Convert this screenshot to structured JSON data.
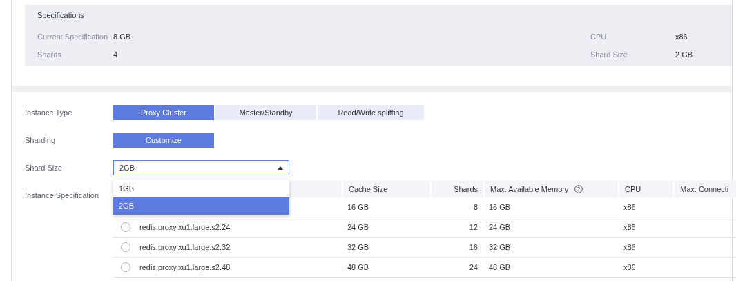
{
  "specifications": {
    "title": "Specifications",
    "items": [
      {
        "label": "Current Specification",
        "value": "8 GB"
      },
      {
        "label": "CPU",
        "value": "x86"
      },
      {
        "label": "Shards",
        "value": "4"
      },
      {
        "label": "Shard Size",
        "value": "2 GB"
      }
    ]
  },
  "instance_type": {
    "label": "Instance Type",
    "options": [
      {
        "label": "Proxy Cluster",
        "selected": true
      },
      {
        "label": "Master/Standby",
        "selected": false
      },
      {
        "label": "Read/Write splitting",
        "selected": false
      }
    ]
  },
  "sharding": {
    "label": "Sharding",
    "options": [
      {
        "label": "Customize",
        "selected": true
      }
    ]
  },
  "shard_size": {
    "label": "Shard Size",
    "value": "2GB",
    "expanded": true,
    "options": [
      {
        "label": "1GB",
        "selected": false
      },
      {
        "label": "2GB",
        "selected": true
      }
    ]
  },
  "instance_specification": {
    "label": "Instance Specification",
    "columns": [
      {
        "label": "Cache Size"
      },
      {
        "label": "Shards"
      },
      {
        "label": "Max. Available Memory",
        "help": true
      },
      {
        "label": "CPU"
      },
      {
        "label": "Max. Connecti"
      }
    ],
    "rows": [
      {
        "cache_size": "16 GB",
        "shards": "8",
        "memory": "16 GB",
        "cpu": "x86"
      },
      {
        "selected": false,
        "name": "redis.proxy.xu1.large.s2.24",
        "cache_size": "24 GB",
        "shards": "12",
        "memory": "24 GB",
        "cpu": "x86"
      },
      {
        "selected": false,
        "name": "redis.proxy.xu1.large.s2.32",
        "cache_size": "32 GB",
        "shards": "16",
        "memory": "32 GB",
        "cpu": "x86"
      },
      {
        "selected": false,
        "name": "redis.proxy.xu1.large.s2.48",
        "cache_size": "48 GB",
        "shards": "24",
        "memory": "48 GB",
        "cpu": "x86"
      }
    ]
  }
}
